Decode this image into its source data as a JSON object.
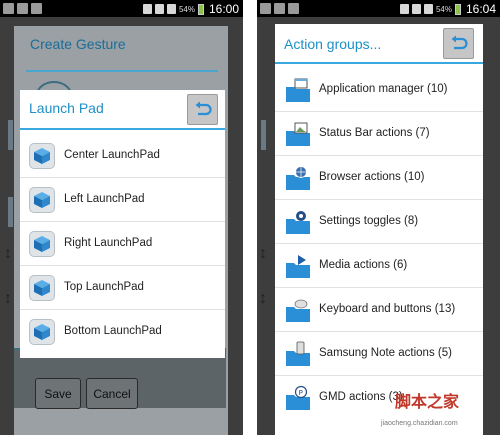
{
  "status_bar": {
    "time": "16:00",
    "battery": "54%"
  },
  "status_bar_right": {
    "time": "16:04",
    "battery": "54%"
  },
  "background": {
    "title": "Create Gesture",
    "save_label": "Save",
    "cancel_label": "Cancel"
  },
  "launchpad": {
    "title": "Launch Pad",
    "items": [
      {
        "label": "Center LaunchPad"
      },
      {
        "label": "Left LaunchPad"
      },
      {
        "label": "Right LaunchPad"
      },
      {
        "label": "Top LaunchPad"
      },
      {
        "label": "Bottom LaunchPad"
      }
    ]
  },
  "action_groups": {
    "title": "Action groups...",
    "items": [
      {
        "label": "Application manager (10)",
        "icon": "window-icon"
      },
      {
        "label": "Status Bar actions (7)",
        "icon": "image-icon"
      },
      {
        "label": "Browser actions (10)",
        "icon": "globe-icon"
      },
      {
        "label": "Settings toggles (8)",
        "icon": "gear-icon"
      },
      {
        "label": "Media actions (6)",
        "icon": "play-icon"
      },
      {
        "label": "Keyboard and buttons (13)",
        "icon": "keyboard-icon"
      },
      {
        "label": "Samsung Note actions (5)",
        "icon": "note-icon"
      },
      {
        "label": "GMD actions (3)",
        "icon": "p-icon"
      }
    ]
  },
  "watermark": {
    "main": "脚本之家",
    "sub": "jiaocheng.chazidian.com"
  },
  "colors": {
    "accent": "#1e90c8",
    "folder": "#2a8fd6"
  }
}
